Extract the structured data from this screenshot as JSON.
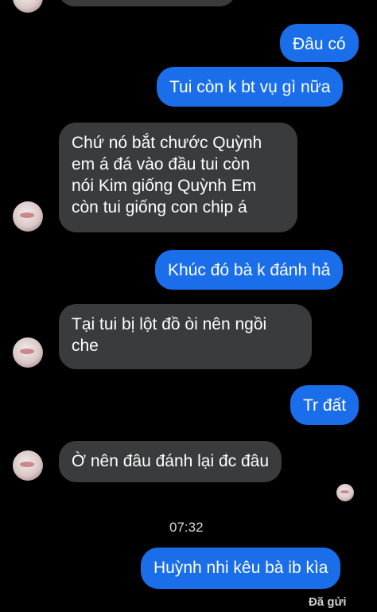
{
  "messages": [
    {
      "side": "in",
      "text": ""
    },
    {
      "side": "out",
      "text": "Đâu có"
    },
    {
      "side": "out",
      "text": "Tui còn k bt vụ gì nữa"
    },
    {
      "side": "in",
      "text": "Chứ nó bắt chước Quỳnh\nem á đá vào đầu tui còn\nnói Kim giống Quỳnh Em\ncòn tui giống con chip á"
    },
    {
      "side": "out",
      "text": "Khúc đó bà k đánh hả"
    },
    {
      "side": "in",
      "text": "Tại tui bị lột đồ òi nên ngồi\nche"
    },
    {
      "side": "out",
      "text": "Tr đất"
    },
    {
      "side": "in",
      "text": "Ờ nên đâu đánh lại đc đâu"
    },
    {
      "side": "out",
      "text": "Huỳnh nhi kêu bà ib kìa"
    }
  ],
  "timestamp": "07:32",
  "status_text": "Đã gửi"
}
